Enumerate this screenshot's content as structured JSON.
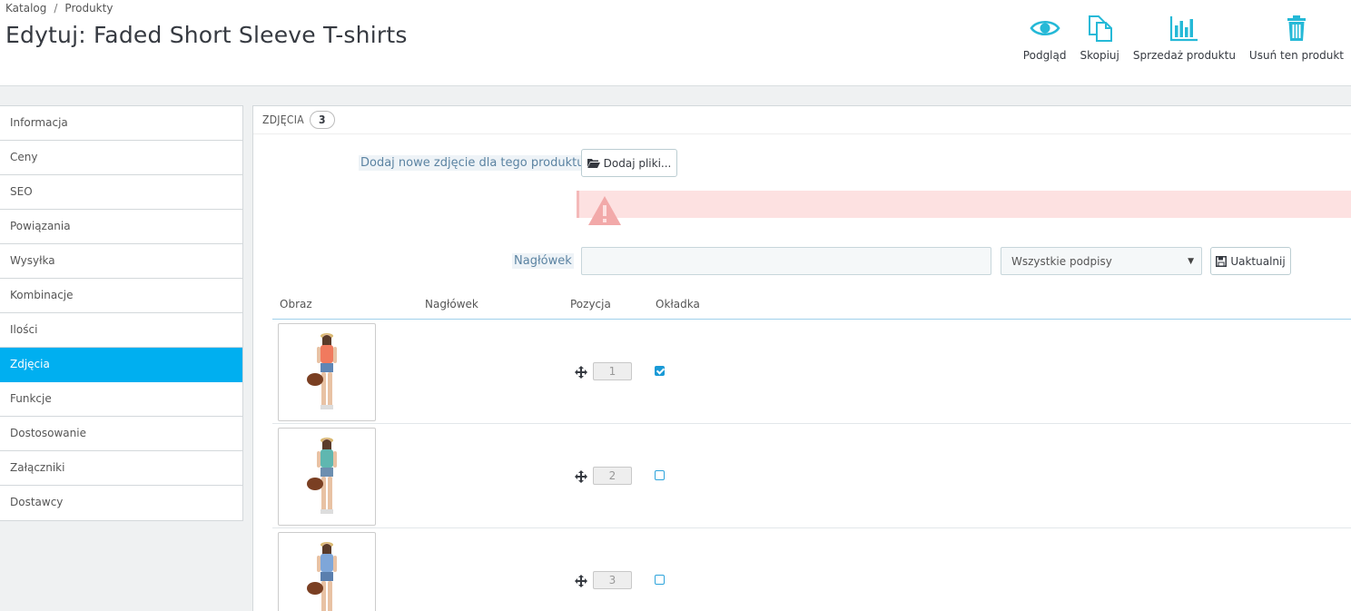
{
  "breadcrumb": {
    "parent": "Katalog",
    "separator": "/",
    "current": "Produkty"
  },
  "page_title": "Edytuj: Faded Short Sleeve T-shirts",
  "toolbar": {
    "preview": "Podgląd",
    "duplicate": "Skopiuj",
    "sales": "Sprzedaż produktu",
    "delete": "Usuń ten produkt",
    "icon_color": "#25b9d7"
  },
  "sidebar": {
    "items": [
      {
        "label": "Informacja"
      },
      {
        "label": "Ceny"
      },
      {
        "label": "SEO"
      },
      {
        "label": "Powiązania"
      },
      {
        "label": "Wysyłka"
      },
      {
        "label": "Kombinacje"
      },
      {
        "label": "Ilości"
      },
      {
        "label": "Zdjęcia",
        "active": true
      },
      {
        "label": "Funkcje"
      },
      {
        "label": "Dostosowanie"
      },
      {
        "label": "Załączniki"
      },
      {
        "label": "Dostawcy"
      }
    ],
    "active_color": "#00aff0"
  },
  "panel": {
    "title": "ZDJĘCIA",
    "count": "3",
    "add_label": "Dodaj nowe zdjęcie dla tego produktu",
    "add_button": "Dodaj pliki...",
    "caption_label": "Nagłówek",
    "caption_value": "",
    "caption_select": "Wszystkie podpisy",
    "update_button": "Uaktualnij"
  },
  "table": {
    "headers": {
      "image": "Obraz",
      "caption": "Nagłówek",
      "position": "Pozycja",
      "cover": "Okładka"
    },
    "rows": [
      {
        "position": "1",
        "cover": true,
        "shirt_color": "#f07a5e",
        "shorts_color": "#5f86b5"
      },
      {
        "position": "2",
        "cover": false,
        "shirt_color": "#5fb7b0",
        "shorts_color": "#6d8fb0"
      },
      {
        "position": "3",
        "cover": false,
        "shirt_color": "#7ea6d9",
        "shorts_color": "#5b7fae"
      }
    ]
  }
}
